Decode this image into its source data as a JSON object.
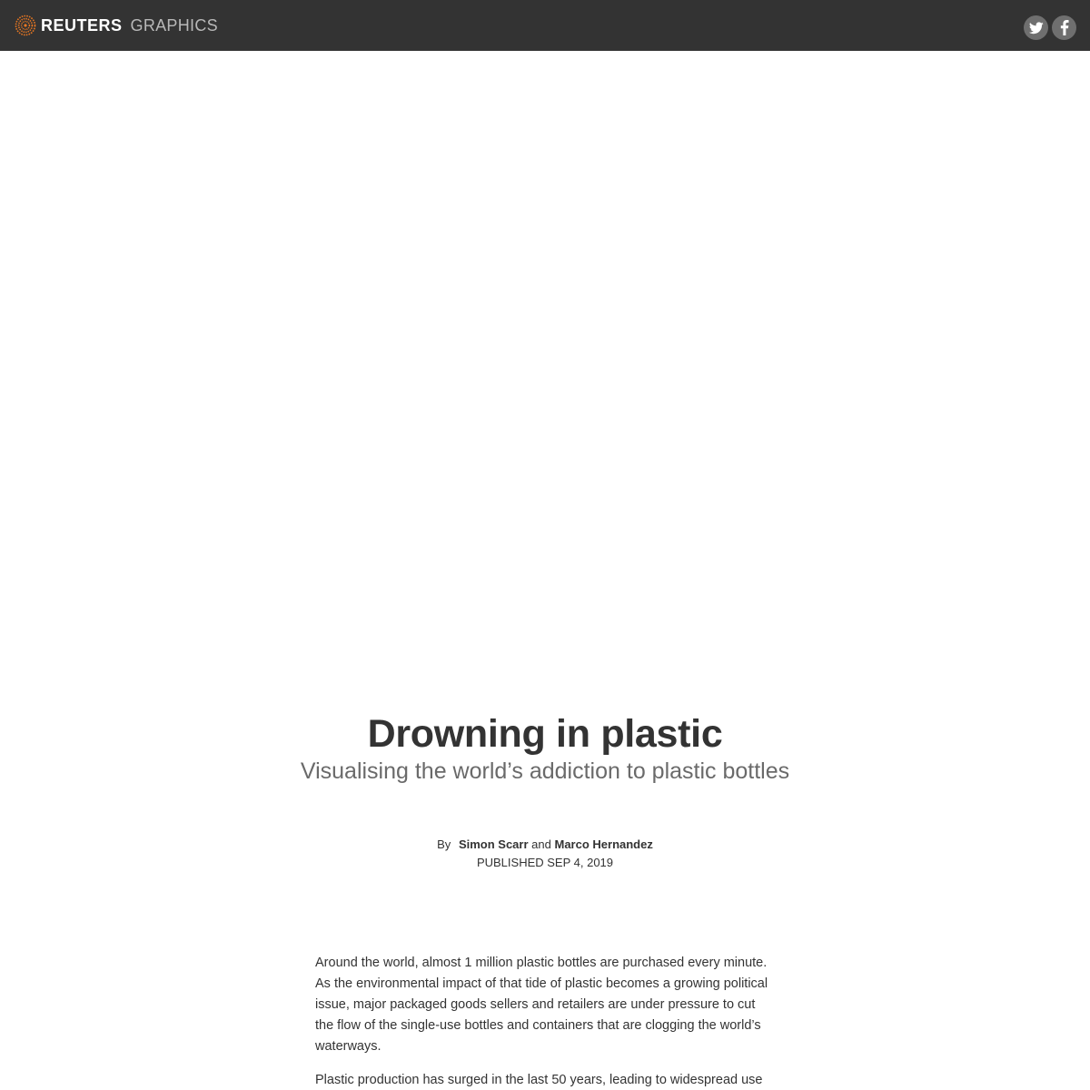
{
  "header": {
    "brand": "REUTERS",
    "section": "GRAPHICS",
    "logo_icon": "reuters-logo-mark",
    "background": "#333333",
    "accent": "#e87722",
    "social": [
      {
        "name": "twitter",
        "icon": "twitter-icon"
      },
      {
        "name": "facebook",
        "icon": "facebook-icon"
      }
    ]
  },
  "article": {
    "title": "Drowning in plastic",
    "subtitle": "Visualising the world’s addiction to plastic bottles",
    "byline": {
      "prefix": "By",
      "author_1": "Simon Scarr",
      "joiner": "and",
      "author_2": "Marco Hernandez"
    },
    "published": "PUBLISHED SEP 4, 2019",
    "paragraphs": [
      "Around the world, almost 1 million plastic bottles are purchased every minute. As the environmental impact of that tide of plastic becomes a growing political issue, major packaged goods sellers and retailers are under pressure to cut the flow of the single-use bottles and containers that are clogging the world’s waterways.",
      "Plastic production has surged in the last 50 years, leading to widespread use of"
    ]
  }
}
